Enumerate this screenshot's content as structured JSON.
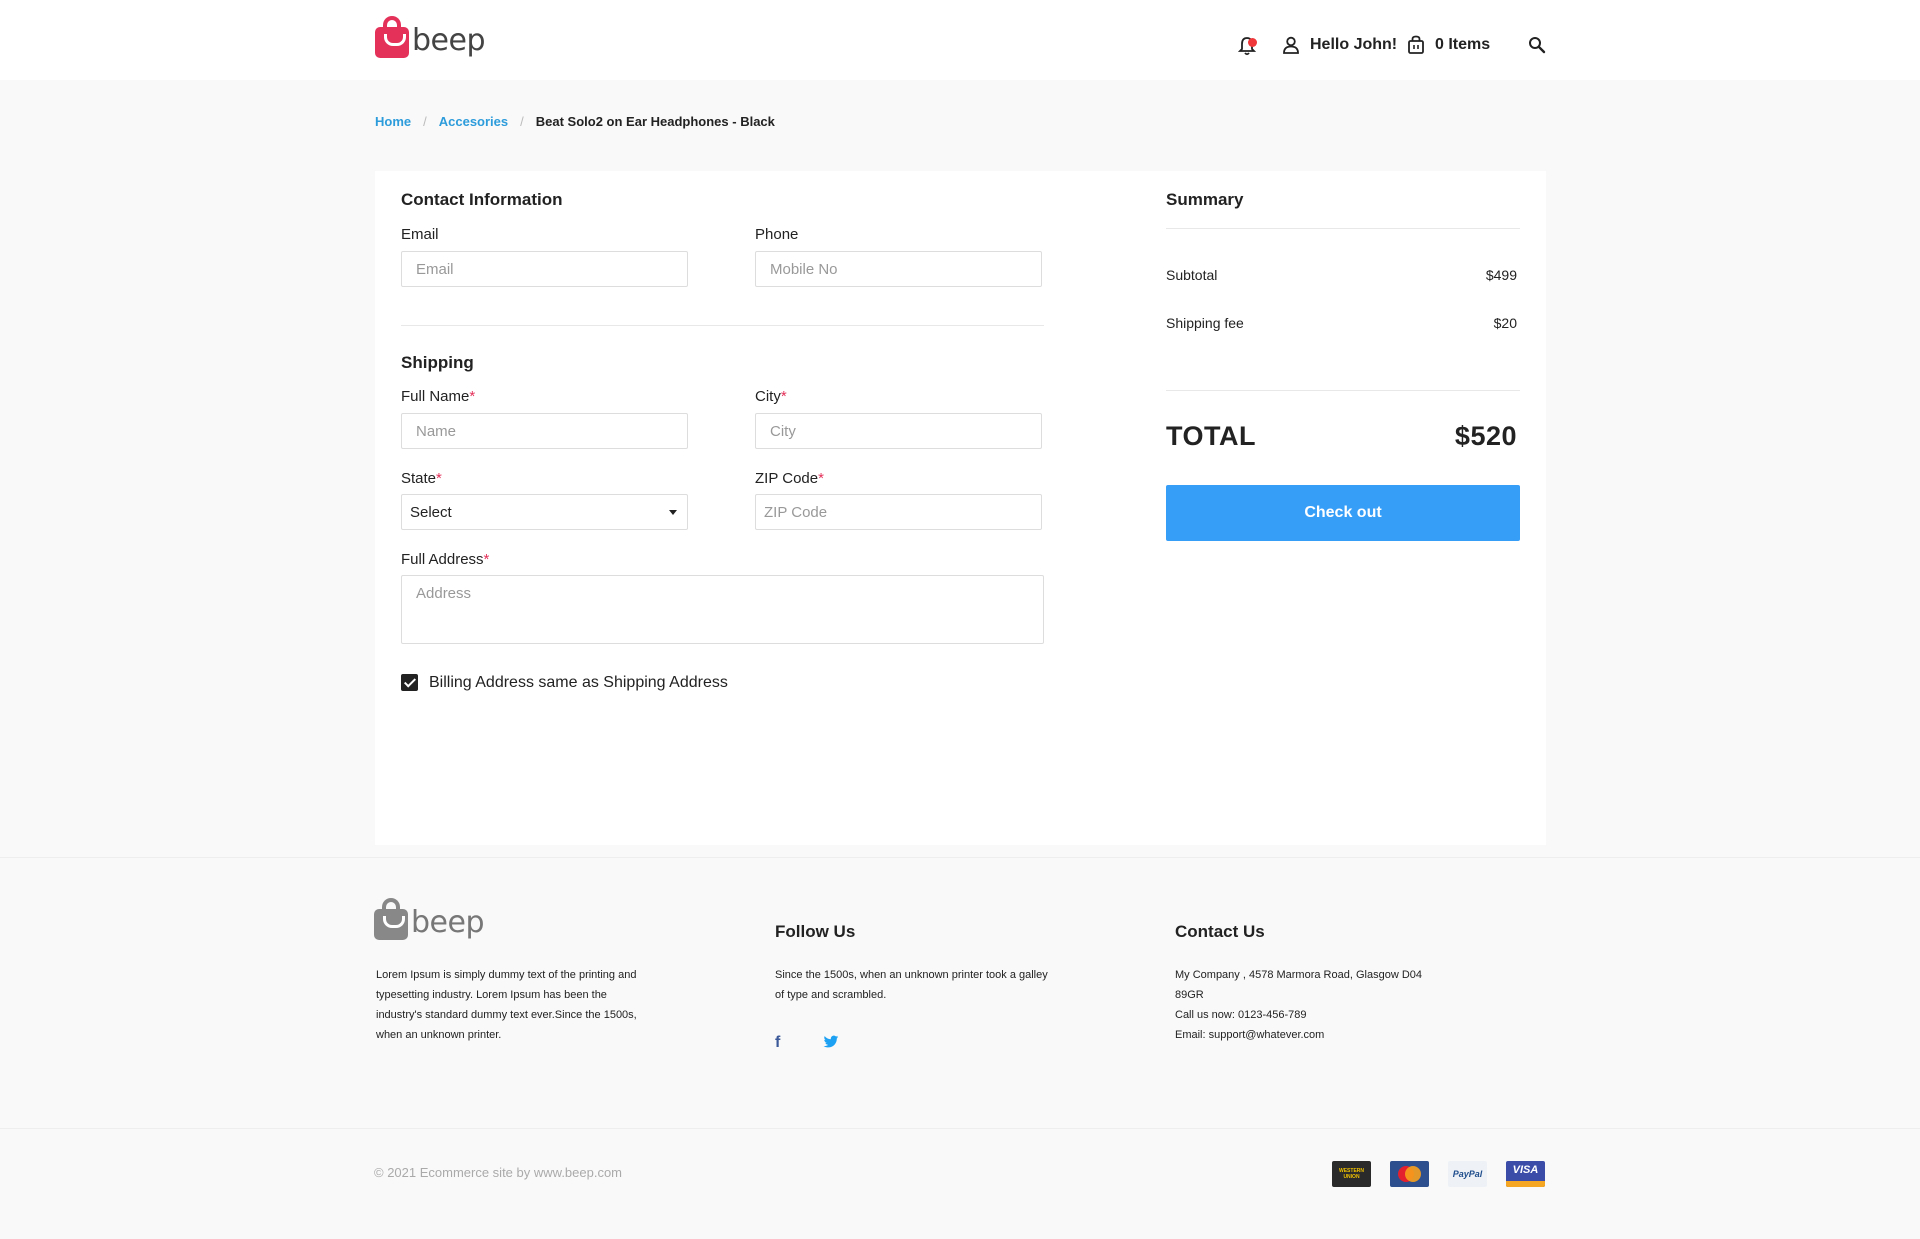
{
  "header": {
    "logo_text": "beep",
    "greeting": "Hello John!",
    "cart_label": "0 Items"
  },
  "breadcrumb": {
    "items": [
      "Home",
      "Accesories"
    ],
    "current": "Beat Solo2 on Ear Headphones - Black"
  },
  "contact": {
    "title": "Contact Information",
    "email_label": "Email",
    "email_placeholder": "Email",
    "phone_label": "Phone",
    "phone_placeholder": "Mobile No"
  },
  "shipping": {
    "title": "Shipping",
    "fullname_label": "Full Name",
    "fullname_placeholder": "Name",
    "city_label": "City",
    "city_placeholder": "City",
    "state_label": "State",
    "state_value": "Select",
    "zip_label": "ZIP Code",
    "zip_placeholder": "ZIP Code",
    "address_label": "Full Address",
    "address_placeholder": "Address",
    "required_mark": "*",
    "billing_same_label": "Billing Address same as Shipping Address",
    "billing_same_checked": true
  },
  "summary": {
    "title": "Summary",
    "subtotal_label": "Subtotal",
    "subtotal_value": "$499",
    "shipping_label": "Shipping fee",
    "shipping_value": "$20",
    "total_label": "TOTAL",
    "total_value": "$520",
    "checkout_label": "Check out",
    "checkout_color": "#379ef7"
  },
  "footer": {
    "logo_text": "beep",
    "about_text": "Lorem Ipsum is simply dummy text of the printing and typesetting industry. Lorem Ipsum has been the industry's standard dummy text ever.Since the 1500s, when an unknown printer.",
    "follow_title": "Follow Us",
    "follow_text": "Since the 1500s, when an unknown printer took a galley of type and scrambled.",
    "contact_title": "Contact Us",
    "contact_address": "My Company , 4578 Marmora Road, Glasgow D04 89GR",
    "contact_phone": "Call us now: 0123-456-789",
    "contact_email": "Email: support@whatever.com",
    "copyright": "© 2021 Ecommerce site by www.beep.com",
    "payment_methods": [
      "western-union",
      "mastercard",
      "paypal",
      "visa"
    ]
  },
  "colors": {
    "brand": "#e4315a",
    "link": "#2d9cdb",
    "button": "#379ef7"
  }
}
